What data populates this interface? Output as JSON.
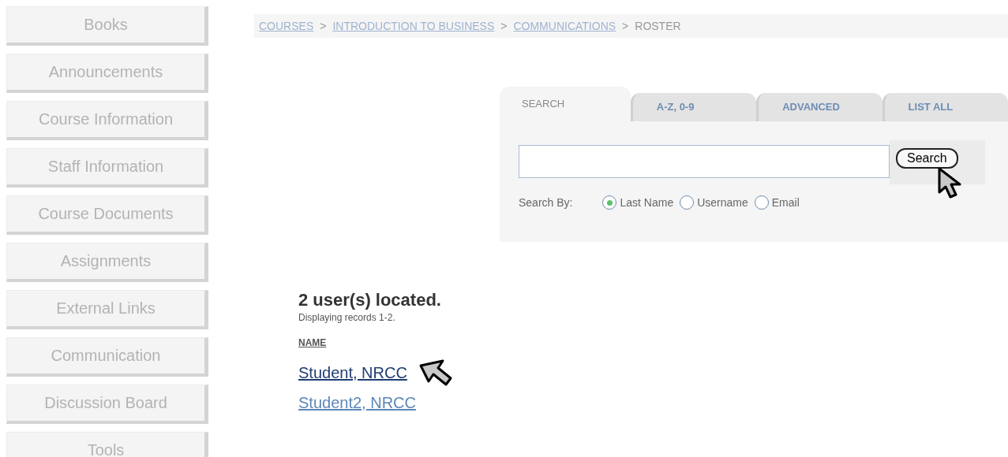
{
  "sidebar": {
    "items": [
      {
        "label": "Books"
      },
      {
        "label": "Announcements"
      },
      {
        "label": "Course Information"
      },
      {
        "label": "Staff Information"
      },
      {
        "label": "Course Documents"
      },
      {
        "label": "Assignments"
      },
      {
        "label": "External Links"
      },
      {
        "label": "Communication"
      },
      {
        "label": "Discussion Board"
      },
      {
        "label": "Tools"
      }
    ]
  },
  "breadcrumb": {
    "items": [
      {
        "label": "COURSES",
        "link": true
      },
      {
        "label": "INTRODUCTION TO BUSINESS",
        "link": true
      },
      {
        "label": "COMMUNICATIONS",
        "link": true
      },
      {
        "label": "ROSTER",
        "link": false
      }
    ],
    "separator": ">"
  },
  "search_panel": {
    "tabs": [
      {
        "label": "SEARCH",
        "selected": true
      },
      {
        "label": "A-Z, 0-9",
        "selected": false
      },
      {
        "label": "ADVANCED",
        "selected": false
      },
      {
        "label": "LIST ALL",
        "selected": false
      }
    ],
    "search_button": "Search",
    "search_by_label": "Search By:",
    "options": [
      {
        "label": "Last Name",
        "selected": true
      },
      {
        "label": "Username",
        "selected": false
      },
      {
        "label": "Email",
        "selected": false
      }
    ]
  },
  "results": {
    "heading": "2 user(s) located.",
    "subheading": "Displaying records 1-2.",
    "column": "NAME",
    "rows": [
      {
        "name": "Student, NRCC",
        "hovered": true
      },
      {
        "name": "Student2, NRCC",
        "hovered": false
      }
    ]
  }
}
